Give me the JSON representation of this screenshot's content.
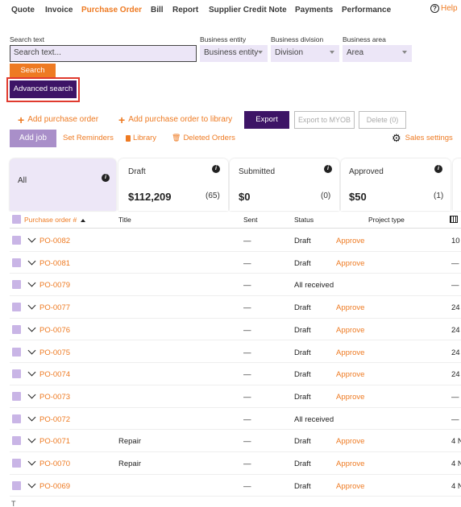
{
  "nav": {
    "items": [
      "Quote",
      "Invoice",
      "Purchase Order",
      "Bill",
      "Report",
      "Supplier Credit Note",
      "Payments",
      "Performance"
    ],
    "active": "Purchase Order",
    "help_label": "Help"
  },
  "filters": {
    "search_label": "Search text",
    "search_placeholder": "Search text...",
    "entity_label": "Business entity",
    "entity_value": "Business entity",
    "division_label": "Business division",
    "division_value": "Division",
    "area_label": "Business area",
    "area_value": "Area",
    "search_button": "Search",
    "advanced_button": "Advanced search"
  },
  "actions": {
    "add_po": "Add purchase order",
    "add_po_library": "Add purchase order to library",
    "export": "Export",
    "export_myob": "Export to MYOB",
    "delete": "Delete (0)",
    "add_job": "Add job",
    "set_reminders": "Set Reminders",
    "library": "Library",
    "deleted_orders": "Deleted Orders",
    "sales_settings": "Sales settings"
  },
  "cards": [
    {
      "title": "All",
      "amount": "",
      "count": ""
    },
    {
      "title": "Draft",
      "amount": "$112,209",
      "count": "(65)"
    },
    {
      "title": "Submitted",
      "amount": "$0",
      "count": "(0)"
    },
    {
      "title": "Approved",
      "amount": "$50",
      "count": "(1)"
    }
  ],
  "table": {
    "columns": [
      "Purchase order #",
      "Title",
      "Sent",
      "Status",
      "Project type"
    ],
    "rows": [
      {
        "po": "PO-0082",
        "title": "",
        "sent": "—",
        "status": "Draft",
        "action": "Approve",
        "extra": "10"
      },
      {
        "po": "PO-0081",
        "title": "",
        "sent": "—",
        "status": "Draft",
        "action": "Approve",
        "extra": "—"
      },
      {
        "po": "PO-0079",
        "title": "",
        "sent": "—",
        "status": "All received",
        "action": "",
        "extra": "—"
      },
      {
        "po": "PO-0077",
        "title": "",
        "sent": "—",
        "status": "Draft",
        "action": "Approve",
        "extra": "24"
      },
      {
        "po": "PO-0076",
        "title": "",
        "sent": "—",
        "status": "Draft",
        "action": "Approve",
        "extra": "24"
      },
      {
        "po": "PO-0075",
        "title": "",
        "sent": "—",
        "status": "Draft",
        "action": "Approve",
        "extra": "24"
      },
      {
        "po": "PO-0074",
        "title": "",
        "sent": "—",
        "status": "Draft",
        "action": "Approve",
        "extra": "24"
      },
      {
        "po": "PO-0073",
        "title": "",
        "sent": "—",
        "status": "Draft",
        "action": "Approve",
        "extra": "—"
      },
      {
        "po": "PO-0072",
        "title": "",
        "sent": "—",
        "status": "All received",
        "action": "",
        "extra": "—"
      },
      {
        "po": "PO-0071",
        "title": "Repair",
        "sent": "—",
        "status": "Draft",
        "action": "Approve",
        "extra": "4 N"
      },
      {
        "po": "PO-0070",
        "title": "Repair",
        "sent": "—",
        "status": "Draft",
        "action": "Approve",
        "extra": "4 N"
      },
      {
        "po": "PO-0069",
        "title": "",
        "sent": "—",
        "status": "Draft",
        "action": "Approve",
        "extra": "4 N"
      }
    ]
  },
  "colors": {
    "accent": "#ee7a22",
    "primary_dark": "#3d1466",
    "checkbox": "#c9b5e6",
    "highlight_outline": "#e03a2e"
  },
  "icons": [
    "question-circle-icon",
    "plus-icon",
    "library-icon",
    "trash-icon",
    "gear-icon",
    "info-icon",
    "sort-up-icon",
    "chevron-down-icon",
    "columns-icon"
  ]
}
